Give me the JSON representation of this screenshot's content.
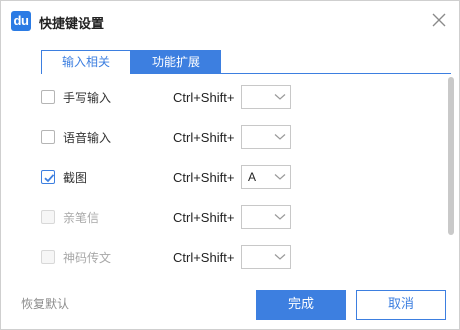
{
  "window": {
    "logo_text": "du",
    "title": "快捷键设置"
  },
  "tabs": [
    {
      "label": "输入相关",
      "active": false
    },
    {
      "label": "功能扩展",
      "active": true
    }
  ],
  "features": [
    {
      "label": "手写输入",
      "checked": false,
      "disabled": false,
      "combo": "Ctrl+Shift+",
      "key": ""
    },
    {
      "label": "语音输入",
      "checked": false,
      "disabled": false,
      "combo": "Ctrl+Shift+",
      "key": ""
    },
    {
      "label": "截图",
      "checked": true,
      "disabled": false,
      "combo": "Ctrl+Shift+",
      "key": "A"
    },
    {
      "label": "亲笔信",
      "checked": false,
      "disabled": true,
      "combo": "Ctrl+Shift+",
      "key": ""
    },
    {
      "label": "神码传文",
      "checked": false,
      "disabled": true,
      "combo": "Ctrl+Shift+",
      "key": ""
    }
  ],
  "footer": {
    "restore_label": "恢复默认",
    "confirm_label": "完成",
    "cancel_label": "取消"
  },
  "colors": {
    "accent": "#3d7fe0",
    "logo": "#2b7be4",
    "disabled": "#a8a8a8"
  },
  "icons": {
    "close": "close-icon",
    "chevron": "chevron-down-icon",
    "check": "check-icon"
  }
}
